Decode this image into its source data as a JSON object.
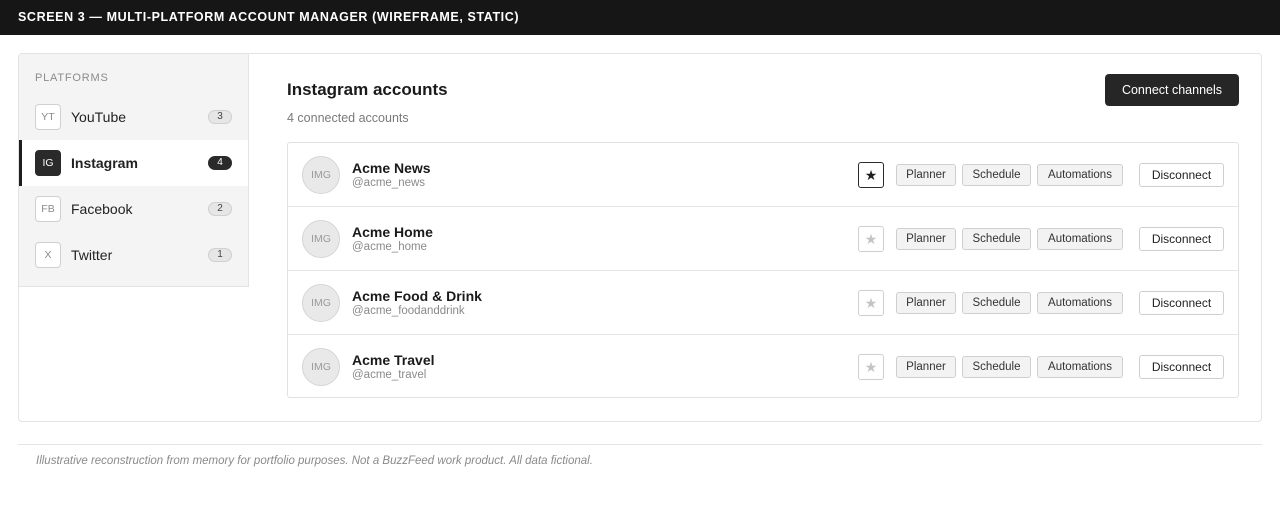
{
  "topbar": {
    "title": "SCREEN 3 — MULTI-PLATFORM ACCOUNT MANAGER (WIREFRAME, STATIC)"
  },
  "sidebar": {
    "heading": "PLATFORMS",
    "items": [
      {
        "abbr": "YT",
        "label": "YouTube",
        "count": "3",
        "active": false
      },
      {
        "abbr": "IG",
        "label": "Instagram",
        "count": "4",
        "active": true
      },
      {
        "abbr": "FB",
        "label": "Facebook",
        "count": "2",
        "active": false
      },
      {
        "abbr": "X",
        "label": "Twitter",
        "count": "1",
        "active": false
      }
    ]
  },
  "main": {
    "title": "Instagram accounts",
    "subtitle": "4 connected accounts",
    "connect_label": "Connect channels",
    "accounts": [
      {
        "avatar": "IMG",
        "name": "Acme News",
        "handle": "@acme_news",
        "starred": true
      },
      {
        "avatar": "IMG",
        "name": "Acme Home",
        "handle": "@acme_home",
        "starred": false
      },
      {
        "avatar": "IMG",
        "name": "Acme Food & Drink",
        "handle": "@acme_foodanddrink",
        "starred": false
      },
      {
        "avatar": "IMG",
        "name": "Acme Travel",
        "handle": "@acme_travel",
        "starred": false
      }
    ],
    "actions": {
      "planner": "Planner",
      "schedule": "Schedule",
      "automations": "Automations",
      "disconnect": "Disconnect"
    },
    "star_icon": "★"
  },
  "footer": {
    "note": "Illustrative reconstruction from memory for portfolio purposes. Not a BuzzFeed work product. All data fictional."
  }
}
